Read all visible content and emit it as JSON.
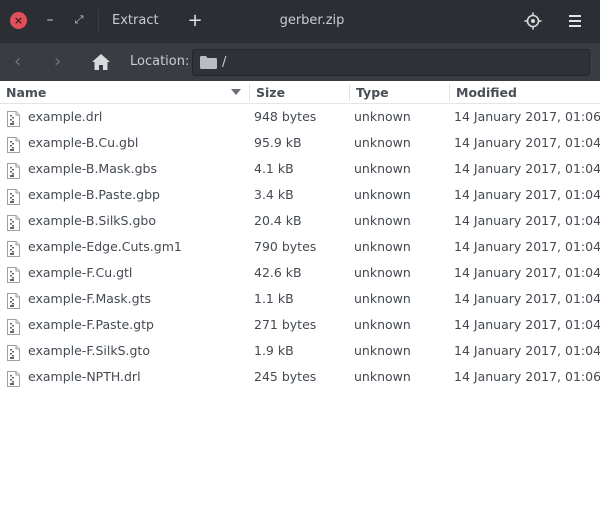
{
  "window": {
    "title": "gerber.zip",
    "extract_label": "Extract",
    "add_label": "+",
    "close_glyph": "×",
    "minimize_glyph": "–",
    "restore_glyph": "⤢"
  },
  "location": {
    "back_glyph": "‹",
    "forward_glyph": "›",
    "label": "Location:",
    "path": "/"
  },
  "columns": {
    "name": "Name",
    "size": "Size",
    "type": "Type",
    "modified": "Modified"
  },
  "files": [
    {
      "name": "example.drl",
      "size": "948 bytes",
      "type": "unknown",
      "modified": "14 January 2017, 01:06"
    },
    {
      "name": "example-B.Cu.gbl",
      "size": "95.9 kB",
      "type": "unknown",
      "modified": "14 January 2017, 01:04"
    },
    {
      "name": "example-B.Mask.gbs",
      "size": "4.1 kB",
      "type": "unknown",
      "modified": "14 January 2017, 01:04"
    },
    {
      "name": "example-B.Paste.gbp",
      "size": "3.4 kB",
      "type": "unknown",
      "modified": "14 January 2017, 01:04"
    },
    {
      "name": "example-B.SilkS.gbo",
      "size": "20.4 kB",
      "type": "unknown",
      "modified": "14 January 2017, 01:04"
    },
    {
      "name": "example-Edge.Cuts.gm1",
      "size": "790 bytes",
      "type": "unknown",
      "modified": "14 January 2017, 01:04"
    },
    {
      "name": "example-F.Cu.gtl",
      "size": "42.6 kB",
      "type": "unknown",
      "modified": "14 January 2017, 01:04"
    },
    {
      "name": "example-F.Mask.gts",
      "size": "1.1 kB",
      "type": "unknown",
      "modified": "14 January 2017, 01:04"
    },
    {
      "name": "example-F.Paste.gtp",
      "size": "271 bytes",
      "type": "unknown",
      "modified": "14 January 2017, 01:04"
    },
    {
      "name": "example-F.SilkS.gto",
      "size": "1.9 kB",
      "type": "unknown",
      "modified": "14 January 2017, 01:04"
    },
    {
      "name": "example-NPTH.drl",
      "size": "245 bytes",
      "type": "unknown",
      "modified": "14 January 2017, 01:06"
    }
  ],
  "colors": {
    "titlebar_bg": "#2b2e33",
    "location_bar_bg": "#393d43",
    "close_button": "#e0505a"
  }
}
